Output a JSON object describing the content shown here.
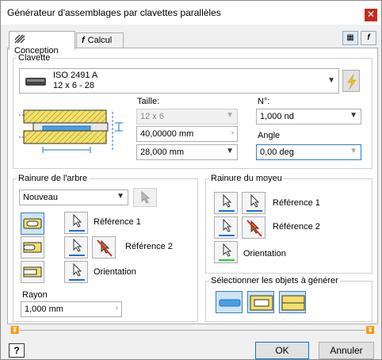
{
  "window": {
    "title": "Générateur d'assemblages par clavettes parallèles",
    "close_label": "✕"
  },
  "tabs": [
    {
      "label": "Conception"
    },
    {
      "label": "Calcul"
    }
  ],
  "clavette": {
    "legend": "Clavette",
    "standard": "ISO 2491 A",
    "dims": "12 x 6 - 28",
    "taille_label": "Taille:",
    "taille_value": "12 x 6",
    "length_value": "40,00000 mm",
    "key_length": "28,000 mm",
    "no_label": "N°:",
    "no_value": "1,000 nd",
    "angle_label": "Angle",
    "angle_value": "0,00 deg"
  },
  "arbre": {
    "legend": "Rainure de l'arbre",
    "mode": "Nouveau",
    "ref1": "Référence 1",
    "ref2": "Référence 2",
    "orientation": "Orientation",
    "rayon_label": "Rayon",
    "rayon_value": "1,000 mm"
  },
  "moyeu": {
    "legend": "Rainure du moyeu",
    "ref1": "Référence 1",
    "ref2": "Référence 2",
    "orientation": "Orientation"
  },
  "generate": {
    "legend": "Sélectionner les objets à générer"
  },
  "footer": {
    "ok_label": "OK",
    "cancel_label": "Annuler",
    "help_icon": "?"
  },
  "colors": {
    "selected_bg": "#cce4f7",
    "selected_border": "#3c7fb1",
    "accent_blue": "#1c6fd1",
    "hatch_yellow": "#f3e06a",
    "red": "#d03020"
  }
}
